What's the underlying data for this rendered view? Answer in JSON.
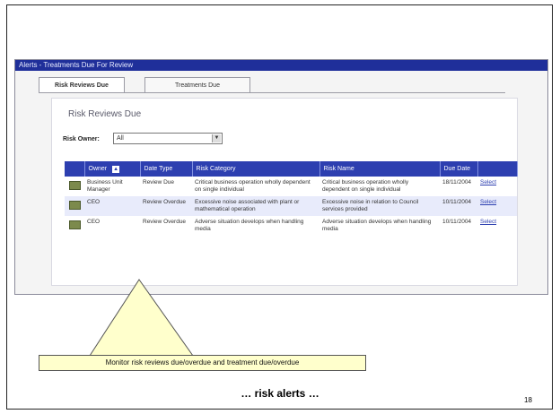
{
  "window": {
    "title": "Alerts - Treatments Due For Review",
    "tabs": [
      {
        "label": "Risk Reviews Due",
        "active": true
      },
      {
        "label": "Treatments Due",
        "active": false
      }
    ]
  },
  "panel": {
    "title": "Risk Reviews Due",
    "owner_label": "Risk Owner:",
    "owner_value": "All"
  },
  "table": {
    "headers": [
      "",
      "Owner",
      "Date Type",
      "Risk Category",
      "Risk Name",
      "Due Date",
      ""
    ],
    "rows": [
      {
        "owner": "Business Unit Manager",
        "date_type": "Review Due",
        "category": "Critical business operation wholly dependent on single individual",
        "name": "Critical business operation wholly dependent on single individual",
        "due": "18/11/2004",
        "action": "Select"
      },
      {
        "owner": "CEO",
        "date_type": "Review Overdue",
        "category": "Excessive noise associated with plant or mathematical operation",
        "name": "Excessive noise in relation to Council services provided",
        "due": "10/11/2004",
        "action": "Select"
      },
      {
        "owner": "CEO",
        "date_type": "Review Overdue",
        "category": "Adverse situation develops when handling media",
        "name": "Adverse situation develops when handling media",
        "due": "10/11/2004",
        "action": "Select"
      }
    ]
  },
  "callout": {
    "text": "Monitor risk reviews due/overdue and treatment due/overdue"
  },
  "footer": {
    "caption": "… risk alerts …",
    "page_number": "18"
  },
  "colors": {
    "titlebar": "#1f2f9a",
    "header": "#2d3fb0",
    "overdue": "#d93c3c",
    "callout_fill": "#ffffcc"
  }
}
